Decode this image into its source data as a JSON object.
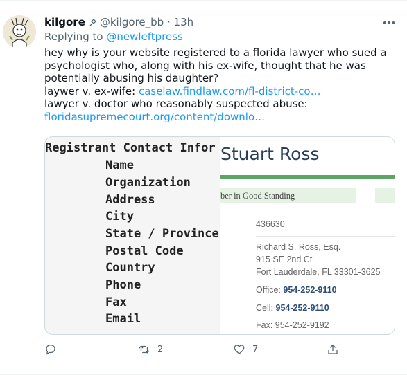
{
  "tweet": {
    "display_name": "kilgore",
    "handle": "@kilgore_bb",
    "time": "· 13h",
    "replying_prefix": "Replying to",
    "replying_to": "@newleftpress",
    "text_line1": "hey why is your website registered to a florida lawyer who sued a psychologist who, along with his ex-wife, thought that he was potentially abusing his daughter?",
    "text_line2_prefix": "laywer v. ex-wife:",
    "text_line2_link": "caselaw.findlaw.com/fl-district-co…",
    "text_line3": "lawyer v. doctor who reasonably suspected abuse:",
    "text_line3_link": "floridasupremecourt.org/content/downlo…"
  },
  "media": {
    "registrant": {
      "title": "Registrant Contact Infor",
      "fields": [
        "Name",
        "Organization",
        "Address",
        "City",
        "State / Province",
        "Postal Code",
        "Country",
        "Phone",
        "Fax",
        "Email"
      ]
    },
    "bar_card": {
      "name": "Stuart Ross",
      "standing": "ber in Good Standing",
      "bar_number": "436630",
      "address_name": "Richard S. Ross, Esq.",
      "address_street": "915 SE 2nd Ct",
      "address_city": "Fort Lauderdale, FL 33301-3625",
      "office_label": "Office:",
      "office_phone": "954-252-9110",
      "cell_label": "Cell:",
      "cell_phone": "954-252-9110",
      "fax": "Fax: 954-252-9192"
    }
  },
  "actions": {
    "reply_count": "",
    "retweet_count": "2",
    "like_count": "7"
  },
  "colors": {
    "link": "#1d9bf0",
    "muted": "#536471",
    "accent_green": "#5aa662"
  }
}
